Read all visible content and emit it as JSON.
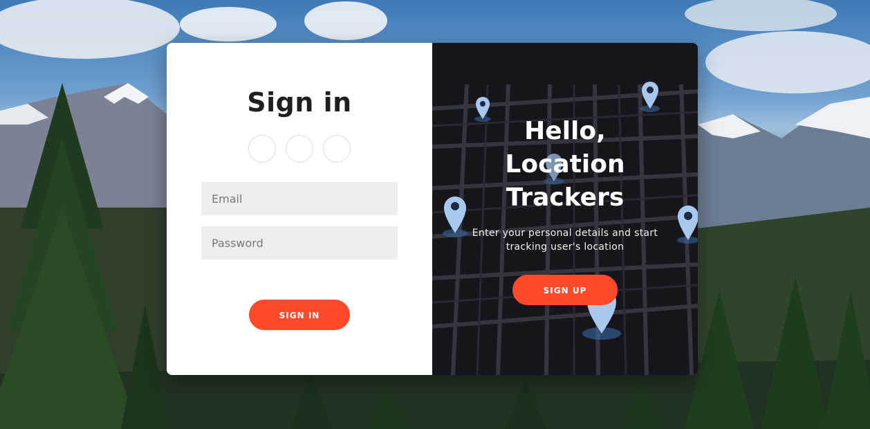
{
  "signin": {
    "title": "Sign in",
    "social": [
      {
        "icon": "social-icon"
      },
      {
        "icon": "social-icon"
      },
      {
        "icon": "social-icon"
      }
    ],
    "email_placeholder": "Email",
    "password_placeholder": "Password",
    "button_label": "SIGN IN"
  },
  "overlay": {
    "title_line1": "Hello,",
    "title_line2": "Location",
    "title_line3": "Trackers",
    "description": "Enter your personal details and start tracking user's location",
    "button_label": "SIGN UP"
  },
  "colors": {
    "accent": "#ff4b2b",
    "overlay_bg": "#16161d",
    "input_bg": "#eeeeee"
  }
}
